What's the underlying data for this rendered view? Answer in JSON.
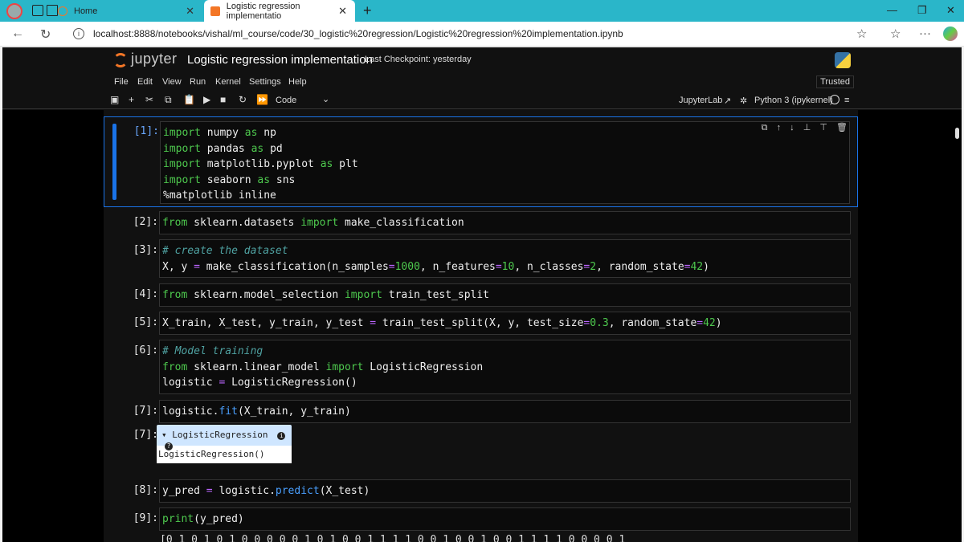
{
  "browser": {
    "tabs": [
      {
        "label": "Home"
      },
      {
        "label": "Logistic regression implementatio"
      }
    ],
    "url": "localhost:8888/notebooks/vishal/ml_course/code/30_logistic%20regression/Logistic%20regression%20implementation.ipynb"
  },
  "jupyter": {
    "logo_text": "jupyter",
    "notebook_title": "Logistic regression implementation",
    "checkpoint": "Last Checkpoint: yesterday",
    "menu": [
      "File",
      "Edit",
      "View",
      "Run",
      "Kernel",
      "Settings",
      "Help"
    ],
    "trusted": "Trusted",
    "toolbar": {
      "cell_type": "Code",
      "jupyterlab": "JupyterLab",
      "kernel": "Python 3 (ipykernel)"
    }
  },
  "cells": [
    {
      "prompt": "[1]:"
    },
    {
      "prompt": "[2]:"
    },
    {
      "prompt": "[3]:"
    },
    {
      "prompt": "[4]:"
    },
    {
      "prompt": "[5]:"
    },
    {
      "prompt": "[6]:"
    },
    {
      "prompt": "[7]:"
    },
    {
      "prompt": "[7]:"
    },
    {
      "prompt": "[8]:"
    },
    {
      "prompt": "[9]:"
    }
  ],
  "output7": {
    "header": "LogisticRegression",
    "body": "LogisticRegression()"
  },
  "output9": {
    "text": "[0 1 0 1 0 1 0 0 0 0 0 1 0 1 0 0 1 1 1 1 0 0 1 0 0 1 0 0 1 1 1 1 0 0 0 0 1"
  },
  "colors": {
    "accent": "#1a73e8",
    "keyword": "#4ec94e",
    "tab_strip": "#2ab6c9"
  }
}
